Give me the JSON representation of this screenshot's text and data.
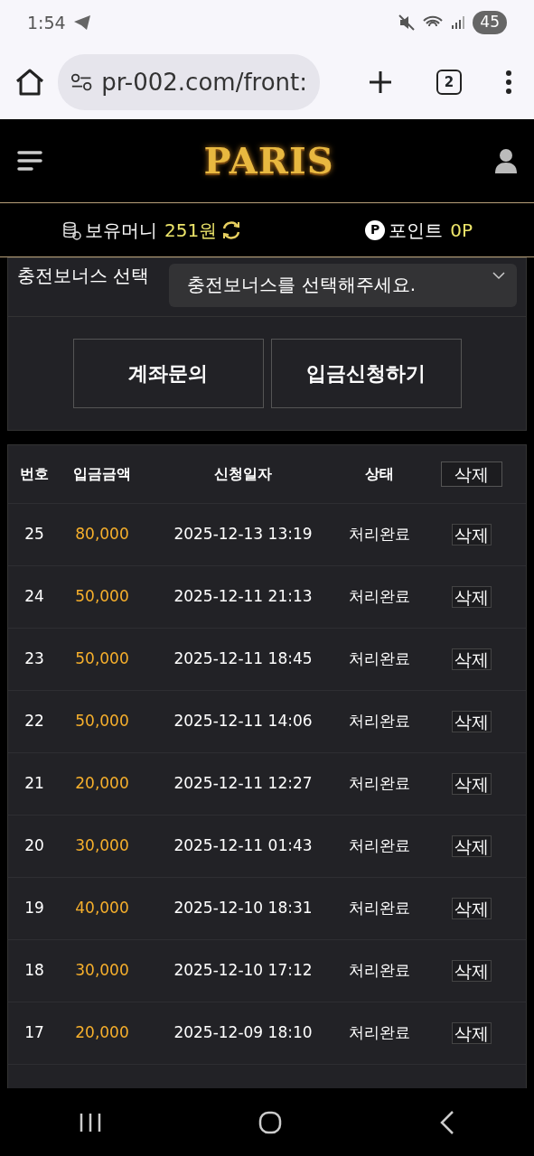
{
  "status_bar": {
    "time": "1:54",
    "battery": "45"
  },
  "browser": {
    "url": "pr-002.com/front:",
    "tab_count": "2"
  },
  "header": {
    "logo": "PARIS"
  },
  "balance": {
    "money_label": "보유머니",
    "money_value": "251원",
    "point_icon": "P",
    "point_label": "포인트",
    "point_value": "0P"
  },
  "bonus": {
    "label": "충전보너스 선택",
    "placeholder": "충전보너스를 선택해주세요."
  },
  "buttons": [
    "계좌문의",
    "입금신청하기"
  ],
  "table": {
    "columns": [
      "번호",
      "입금금액",
      "신청일자",
      "상태"
    ],
    "header_button": "삭제",
    "rows": [
      {
        "no": "25",
        "amount": "80,000",
        "date": "2025-12-13 13:19",
        "status": "처리완료",
        "action": "삭제"
      },
      {
        "no": "24",
        "amount": "50,000",
        "date": "2025-12-11 21:13",
        "status": "처리완료",
        "action": "삭제"
      },
      {
        "no": "23",
        "amount": "50,000",
        "date": "2025-12-11 18:45",
        "status": "처리완료",
        "action": "삭제"
      },
      {
        "no": "22",
        "amount": "50,000",
        "date": "2025-12-11 14:06",
        "status": "처리완료",
        "action": "삭제"
      },
      {
        "no": "21",
        "amount": "20,000",
        "date": "2025-12-11 12:27",
        "status": "처리완료",
        "action": "삭제"
      },
      {
        "no": "20",
        "amount": "30,000",
        "date": "2025-12-11 01:43",
        "status": "처리완료",
        "action": "삭제"
      },
      {
        "no": "19",
        "amount": "40,000",
        "date": "2025-12-10 18:31",
        "status": "처리완료",
        "action": "삭제"
      },
      {
        "no": "18",
        "amount": "30,000",
        "date": "2025-12-10 17:12",
        "status": "처리완료",
        "action": "삭제"
      },
      {
        "no": "17",
        "amount": "20,000",
        "date": "2025-12-09 18:10",
        "status": "처리완료",
        "action": "삭제"
      }
    ]
  }
}
